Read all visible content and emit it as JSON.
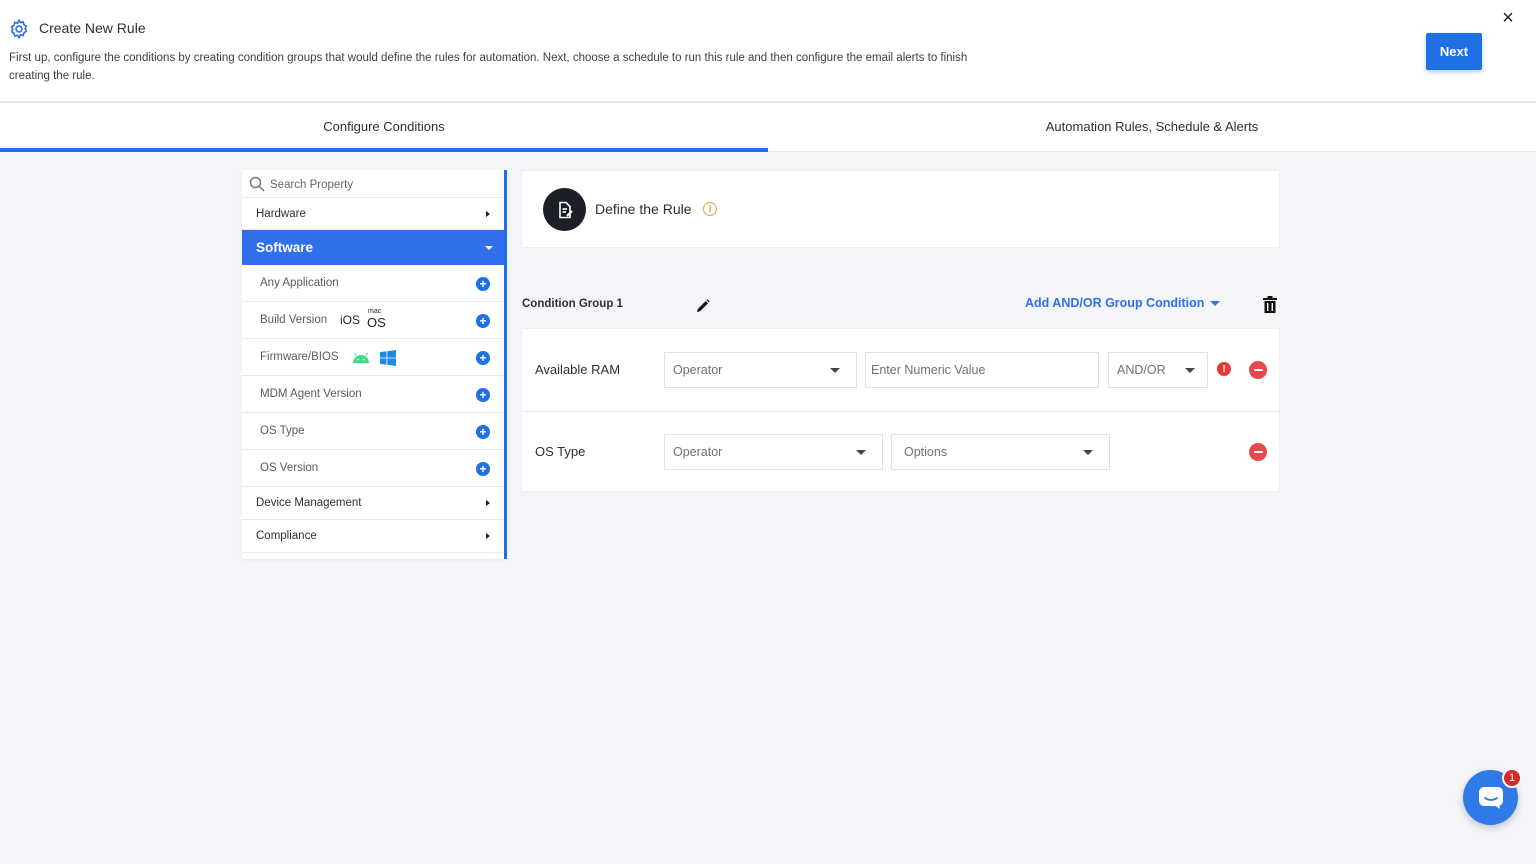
{
  "header": {
    "title": "Create New Rule",
    "description": "First up, configure the conditions by creating condition groups that would define the rules for automation. Next, choose a schedule to run this rule and then configure the email alerts to finish creating the rule.",
    "next_label": "Next",
    "close_glyph": "×",
    "icon": "gear-icon"
  },
  "tabs": [
    {
      "label": "Configure Conditions",
      "active": true
    },
    {
      "label": "Automation Rules, Schedule & Alerts",
      "active": false
    }
  ],
  "sidebar": {
    "search_placeholder": "Search Property",
    "categories": {
      "hardware": "Hardware",
      "software": "Software",
      "device_management": "Device Management",
      "compliance": "Compliance"
    },
    "software_items": [
      {
        "label": "Any Application"
      },
      {
        "label": "Build Version",
        "badges": [
          "iOS",
          "mac",
          "OS"
        ]
      },
      {
        "label": "Firmware/BIOS",
        "icons": [
          "android-icon",
          "windows-icon"
        ]
      },
      {
        "label": "MDM Agent Version"
      },
      {
        "label": "OS Type"
      },
      {
        "label": "OS Version"
      }
    ],
    "plus_glyph": "+"
  },
  "rule": {
    "title": "Define the Rule",
    "info_glyph": "i",
    "group_label": "Condition Group 1",
    "add_group_label": "Add AND/OR Group Condition",
    "conditions": [
      {
        "property": "Available RAM",
        "operator": "Operator",
        "value_placeholder": "Enter Numeric Value",
        "join": "AND/OR",
        "has_error": true
      },
      {
        "property": "OS Type",
        "operator": "Operator",
        "options": "Options"
      }
    ],
    "error_glyph": "!"
  },
  "chat": {
    "badge_count": "1"
  },
  "colors": {
    "accent": "#1f6fe5",
    "danger": "#e5484d",
    "warning": "#f0a033"
  }
}
